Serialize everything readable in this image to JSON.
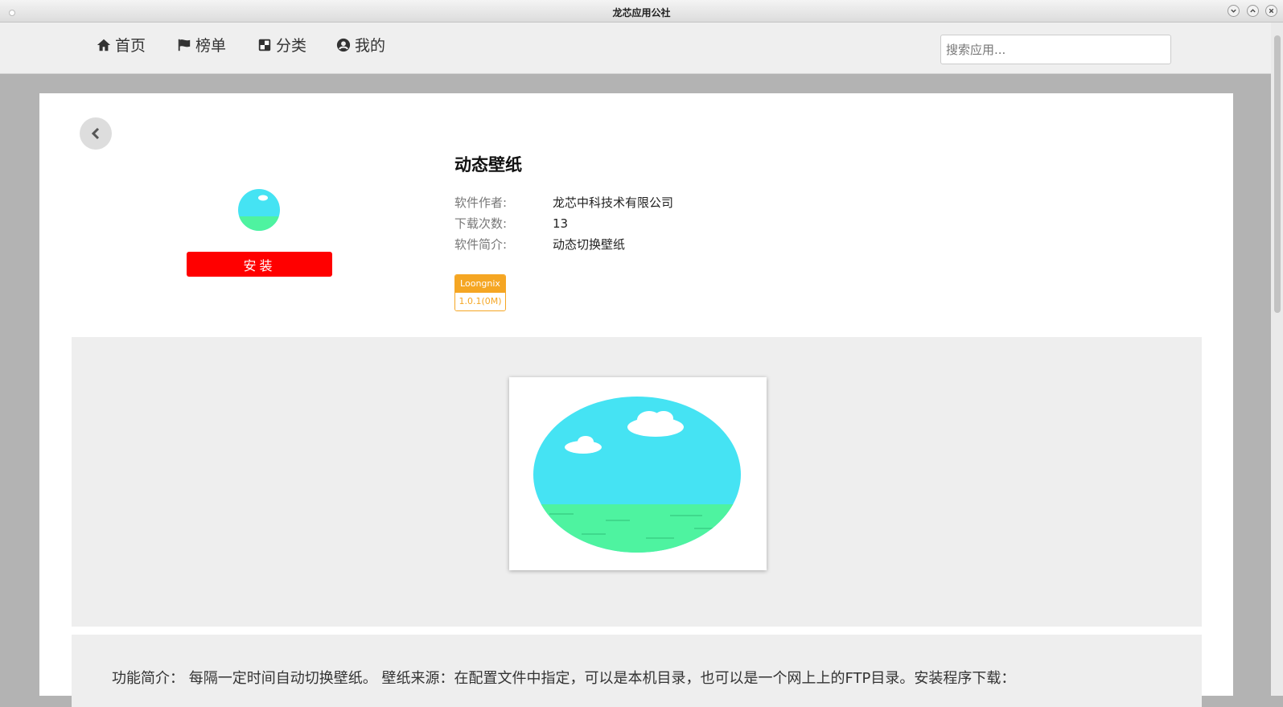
{
  "window": {
    "title": "龙芯应用公社"
  },
  "nav": {
    "items": [
      {
        "label": "首页",
        "icon": "home-icon"
      },
      {
        "label": "榜单",
        "icon": "flag-icon"
      },
      {
        "label": "分类",
        "icon": "category-icon"
      },
      {
        "label": "我的",
        "icon": "user-icon"
      }
    ],
    "search_placeholder": "搜索应用..."
  },
  "app": {
    "name": "动态壁纸",
    "install_label": "安装",
    "author_label": "软件作者:",
    "author": "龙芯中科技术有限公司",
    "downloads_label": "下载次数:",
    "downloads": "13",
    "intro_label": "软件简介:",
    "intro": "动态切换壁纸",
    "tag_os": "Loongnix",
    "tag_version": "1.0.1(0M)"
  },
  "description": "功能简介： 每隔一定时间自动切换壁纸。 壁纸来源：在配置文件中指定，可以是本机目录，也可以是一个网上上的FTP目录。安装程序下载：",
  "colors": {
    "install": "#ff0000",
    "tag": "#f5a623",
    "sky": "#45e3f3",
    "grass": "#4ef3a0"
  }
}
